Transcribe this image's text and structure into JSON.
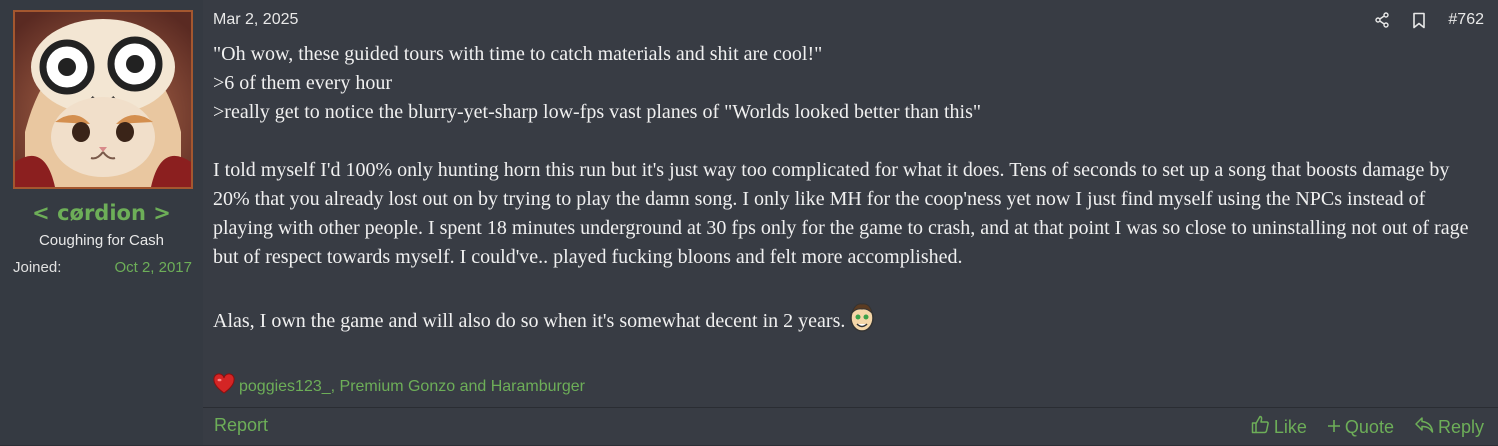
{
  "user": {
    "username": "< cørdion >",
    "title": "Coughing for Cash",
    "joined_label": "Joined:",
    "joined_date": "Oct 2, 2017"
  },
  "post": {
    "date": "Mar 2, 2025",
    "number": "#762",
    "paragraphs": [
      "\"Oh wow, these guided tours with time to catch materials and shit are cool!\"",
      ">6 of them every hour",
      ">really get to notice the blurry-yet-sharp low-fps vast planes of \"Worlds looked better than this\"",
      "",
      "I told myself I'd 100% only hunting horn this run but it's just way too complicated for what it does. Tens of seconds to set up a song that boosts damage by 20% that you already lost out on by trying to play the damn song. I only like MH for the coop'ness yet now I just find myself using the NPCs instead of playing with other people. I spent 18 minutes underground at 30 fps only for the game to crash, and at that point I was so close to uninstalling not out of rage but of respect towards myself. I could've.. played fucking bloons and felt more accomplished.",
      "",
      "Alas, I own the game and will also do so when it's somewhat decent in 2 years."
    ],
    "reactions": "poggies123_, Premium Gonzo and Haramburger"
  },
  "footer": {
    "report": "Report",
    "like": "Like",
    "quote": "Quote",
    "reply": "Reply"
  },
  "icons": {
    "share": "share-icon",
    "bookmark": "bookmark-icon",
    "heart": "heart-icon",
    "thumb": "thumbs-up-icon",
    "plus": "plus-icon",
    "reply": "reply-arrow-icon",
    "emoji": "grinning-face-emoji"
  },
  "colors": {
    "accent": "#6dae58",
    "avatar_border": "#a4572f"
  }
}
